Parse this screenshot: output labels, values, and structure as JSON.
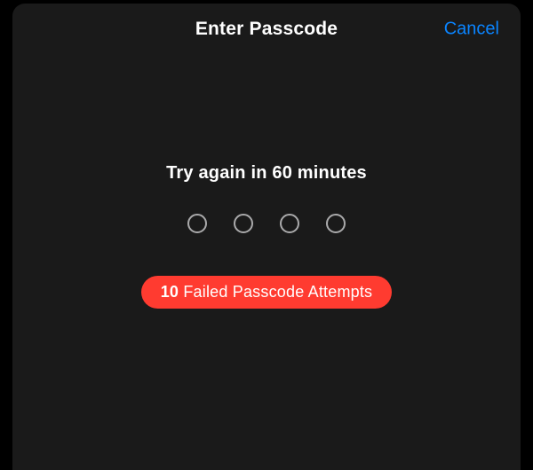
{
  "header": {
    "title": "Enter Passcode",
    "cancel": "Cancel"
  },
  "lockout": {
    "message": "Try again in 60 minutes"
  },
  "passcode": {
    "length": 4
  },
  "error": {
    "count": "10",
    "text": "Failed Passcode Attempts"
  },
  "colors": {
    "accent": "#0a84ff",
    "error": "#ff3b30",
    "panel": "#1a1a1a"
  }
}
